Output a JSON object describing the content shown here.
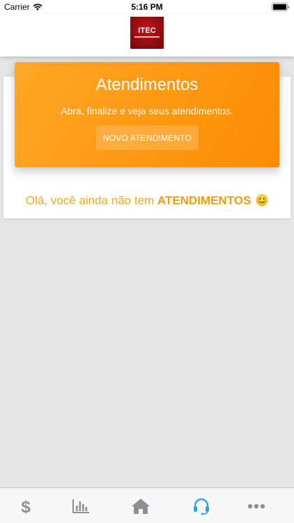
{
  "status_bar": {
    "carrier": "Carrier",
    "time": "5:16 PM"
  },
  "header": {
    "logo_text": "ITEC"
  },
  "banner": {
    "title": "Atendimentos",
    "subtitle": "Abra, finalize e veja seus atendimentos.",
    "button_label": "NOVO ATENDIMENTO"
  },
  "empty_state": {
    "prefix": "Olá, você ainda não tem ",
    "highlight": "ATENDIMENTOS"
  },
  "tab_bar": {
    "items": [
      {
        "icon": "dollar-icon",
        "active": false
      },
      {
        "icon": "chart-icon",
        "active": false
      },
      {
        "icon": "home-icon",
        "active": false
      },
      {
        "icon": "headset-icon",
        "active": true
      },
      {
        "icon": "more-icon",
        "active": false
      }
    ]
  },
  "colors": {
    "accent": "#fb8c00",
    "accent_light": "#ffa726",
    "tab_active": "#29a9e1",
    "tab_inactive": "#8e8e93"
  }
}
